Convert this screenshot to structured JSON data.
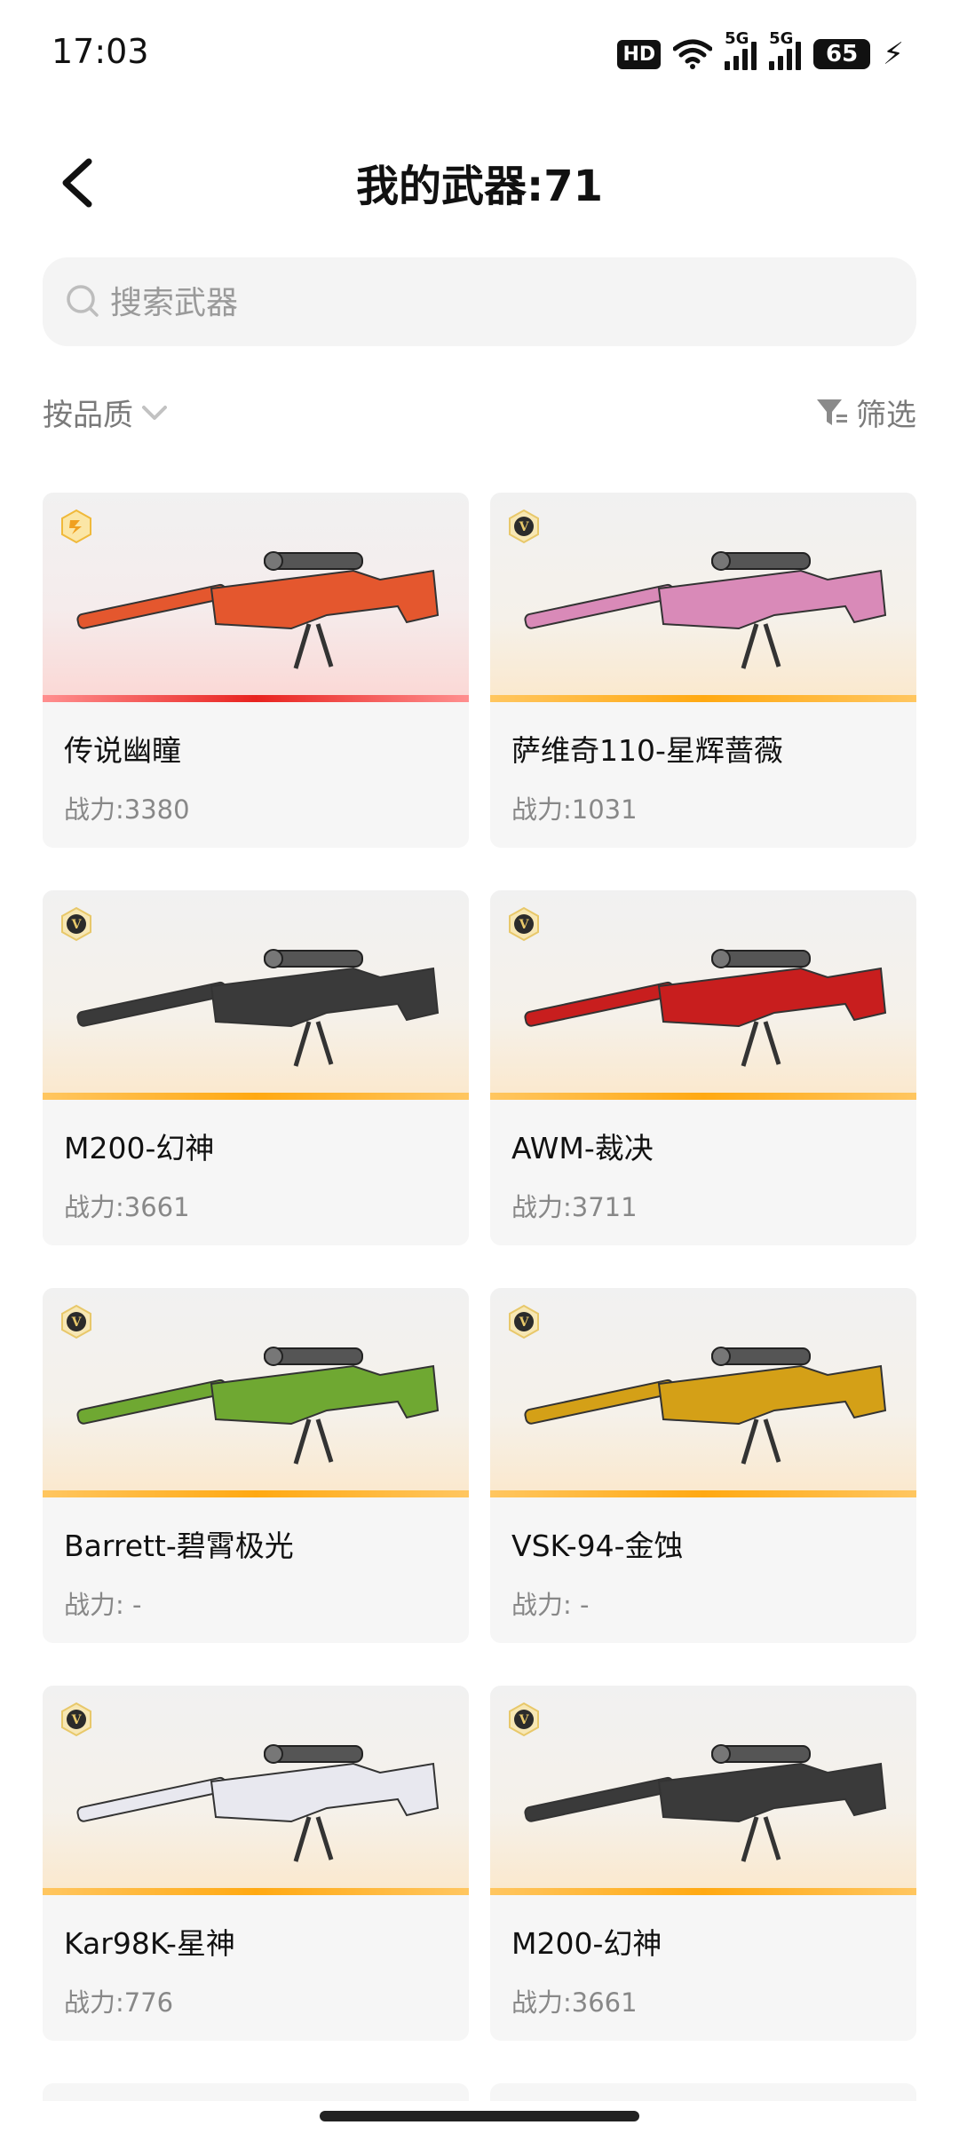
{
  "status": {
    "time": "17:03",
    "hd": "HD",
    "net1": "5G",
    "net2": "5G",
    "battery": "65"
  },
  "header": {
    "title": "我的武器:71"
  },
  "search": {
    "placeholder": "搜索武器"
  },
  "sort": {
    "label": "按品质"
  },
  "filter": {
    "label": "筛选"
  },
  "weapons": [
    {
      "name": "传说幽瞳",
      "power": "战力:3380",
      "quality": "legend",
      "gun_color": "#e4572e"
    },
    {
      "name": "萨维奇110-星辉蔷薇",
      "power": "战力:1031",
      "quality": "v",
      "gun_color": "#d98ab8"
    },
    {
      "name": "M200-幻神",
      "power": "战力:3661",
      "quality": "v",
      "gun_color": "#3a3a3a"
    },
    {
      "name": "AWM-裁决",
      "power": "战力:3711",
      "quality": "v",
      "gun_color": "#c81e1e"
    },
    {
      "name": "Barrett-碧霄极光",
      "power": "战力: -",
      "quality": "v",
      "gun_color": "#6fa832"
    },
    {
      "name": "VSK-94-金蚀",
      "power": "战力: -",
      "quality": "v",
      "gun_color": "#d4a017"
    },
    {
      "name": "Kar98K-星神",
      "power": "战力:776",
      "quality": "v",
      "gun_color": "#e8e8ef"
    },
    {
      "name": "M200-幻神",
      "power": "战力:3661",
      "quality": "v",
      "gun_color": "#3a3a3a"
    }
  ]
}
